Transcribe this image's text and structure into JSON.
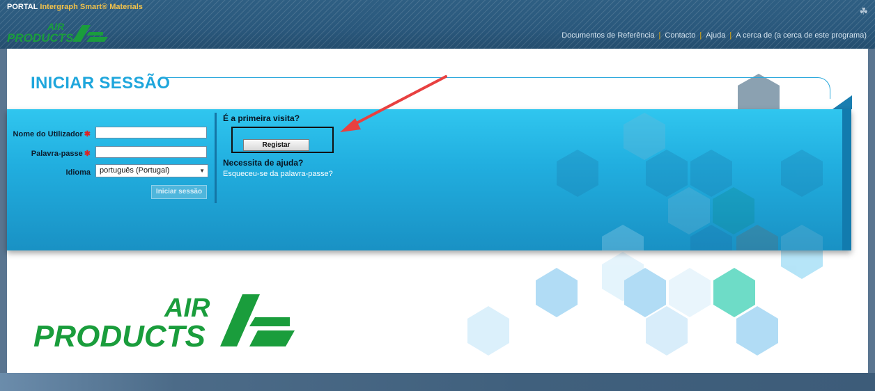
{
  "header": {
    "portal": "PORTAL",
    "product": "Intergraph Smart® Materials",
    "nav": [
      "Documentos de Referência",
      "Contacto",
      "Ajuda",
      "A cerca de (a cerca de este programa)"
    ]
  },
  "logo": {
    "line1": "AIR",
    "line2": "PRODUCTS"
  },
  "login": {
    "title": "INICIAR SESSÃO",
    "username_label": "Nome do Utilizador",
    "password_label": "Palavra-passe",
    "language_label": "Idioma",
    "language_value": "português (Portugal)",
    "login_button": "Iniciar sessão",
    "required_mark": "✱"
  },
  "register": {
    "first_visit": "É a primeira visita?",
    "register_button": "Registar",
    "need_help": "Necessita de ajuda?",
    "forgot_link": "Esqueceu-se da palavra-passe?"
  },
  "colors": {
    "accent": "#1ea6dc",
    "brand_green": "#1a9d3c",
    "header": "#2a587c",
    "annotation_arrow": "#e84040"
  }
}
